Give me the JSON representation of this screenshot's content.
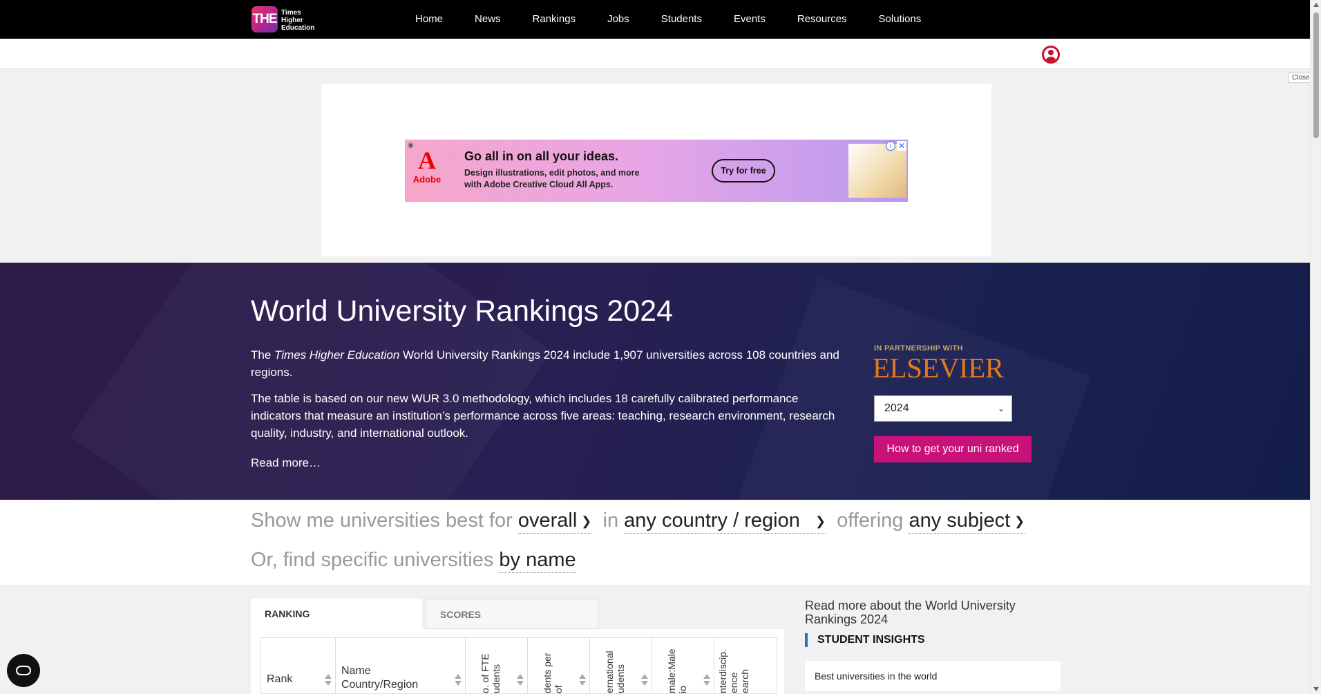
{
  "header": {
    "logo_mark": "THE",
    "logo_text": "Times Higher Education",
    "nav": [
      "Home",
      "News",
      "Rankings",
      "Jobs",
      "Students",
      "Events",
      "Resources",
      "Solutions"
    ]
  },
  "ad": {
    "close_label": "Close",
    "brand": "Adobe",
    "headline": "Go all in on all your ideas.",
    "body": "Design illustrations, edit photos, and more with Adobe Creative Cloud All Apps.",
    "cta": "Try for free"
  },
  "hero": {
    "title": "World University Rankings 2024",
    "p1_prefix": "The ",
    "p1_italic": "Times Higher Education",
    "p1_suffix": " World University Rankings 2024 include 1,907 universities across 108 countries and regions.",
    "p2": "The table is based on our new WUR 3.0 methodology, which includes 18 carefully calibrated performance indicators that measure an institution’s performance across five areas: teaching, research environment, research quality, industry, and international outlook.",
    "read_more": "Read more…",
    "partner_caption": "IN PARTNERSHIP WITH",
    "partner_name": "ELSEVIER",
    "year_selected": "2024",
    "get_ranked_label": "How to get your uni ranked"
  },
  "filters": {
    "row1_lead": "Show me universities best for",
    "best_for": "overall",
    "in_label": "in",
    "country": "any country / region",
    "offering_label": "offering",
    "subject": "any subject",
    "row2_lead": "Or, find specific universities",
    "by_name": "by name"
  },
  "table": {
    "tabs": [
      "RANKING",
      "SCORES"
    ],
    "col_rank": "Rank",
    "col_name_1": "Name",
    "col_name_2": "Country/Region",
    "col_fte": "o. of FTE\nudents",
    "col_students_staff": "dents per\nof",
    "col_intl": "ernational\nudents",
    "col_female": "male:Male\nio",
    "col_interdisc": "nterdiscip.\nence\nearch"
  },
  "aside": {
    "title": "Read more about the World University Rankings 2024",
    "section": "STUDENT INSIGHTS",
    "item": "Best universities in the world"
  },
  "colors": {
    "nav_bg": "#000000",
    "cta_pink": "#c8127a",
    "elsevier_orange": "#e07a1e",
    "user_red": "#c8102e"
  },
  "icons": [
    "user-icon",
    "accessibility-icon",
    "chevron-down-icon",
    "sort-icon",
    "ad-close-icon",
    "ad-info-icon"
  ]
}
